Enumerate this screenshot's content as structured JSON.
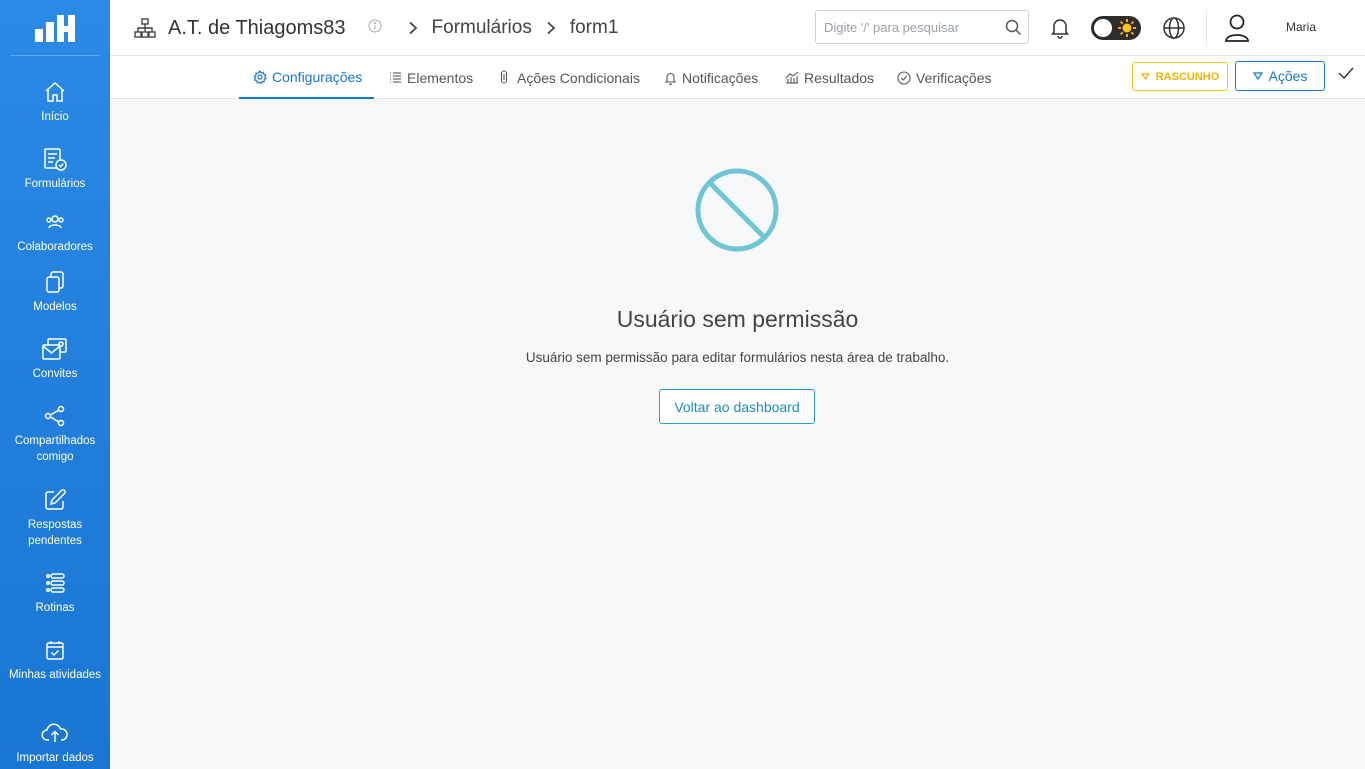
{
  "sidebar": {
    "logo": "app-logo",
    "items": [
      {
        "label": "Início",
        "icon": "home-icon"
      },
      {
        "label": "Formulários",
        "icon": "form-check-icon"
      },
      {
        "label": "Colaboradores",
        "icon": "users-icon"
      },
      {
        "label": "Modelos",
        "icon": "copy-icon"
      },
      {
        "label": "Convites",
        "icon": "invite-icon"
      },
      {
        "label": "Compartilhados comigo",
        "icon": "share-icon"
      },
      {
        "label": "Respostas pendentes",
        "icon": "edit-icon"
      },
      {
        "label": "Rotinas",
        "icon": "list-icon"
      },
      {
        "label": "Minhas atividades",
        "icon": "calendar-check-icon"
      },
      {
        "label": "Importar dados",
        "icon": "cloud-upload-icon"
      }
    ]
  },
  "header": {
    "workspace": "A.T. de Thiagoms83",
    "breadcrumbs": [
      "Formulários",
      "form1"
    ],
    "search_placeholder": "Digite '/' para pesquisar",
    "username": "Maria"
  },
  "tabs": [
    {
      "label": "Configurações",
      "icon": "gear-icon",
      "active": true
    },
    {
      "label": "Elementos",
      "icon": "list-icon"
    },
    {
      "label": "Ações Condicionais",
      "icon": "thermometer-icon"
    },
    {
      "label": "Notificações",
      "icon": "bell-icon"
    },
    {
      "label": "Resultados",
      "icon": "chart-icon"
    },
    {
      "label": "Verificações",
      "icon": "check-circle-icon"
    }
  ],
  "actions": {
    "draft_label": "RASCUNHO",
    "actions_label": "Ações"
  },
  "main": {
    "title": "Usuário sem permissão",
    "message": "Usuário sem permissão para editar formulários nesta área de trabalho.",
    "back_button": "Voltar ao dashboard"
  },
  "colors": {
    "sidebar": "#1976d2",
    "accent": "#1976d2",
    "deny_icon": "#6ec6d4",
    "draft": "#f0c419"
  }
}
